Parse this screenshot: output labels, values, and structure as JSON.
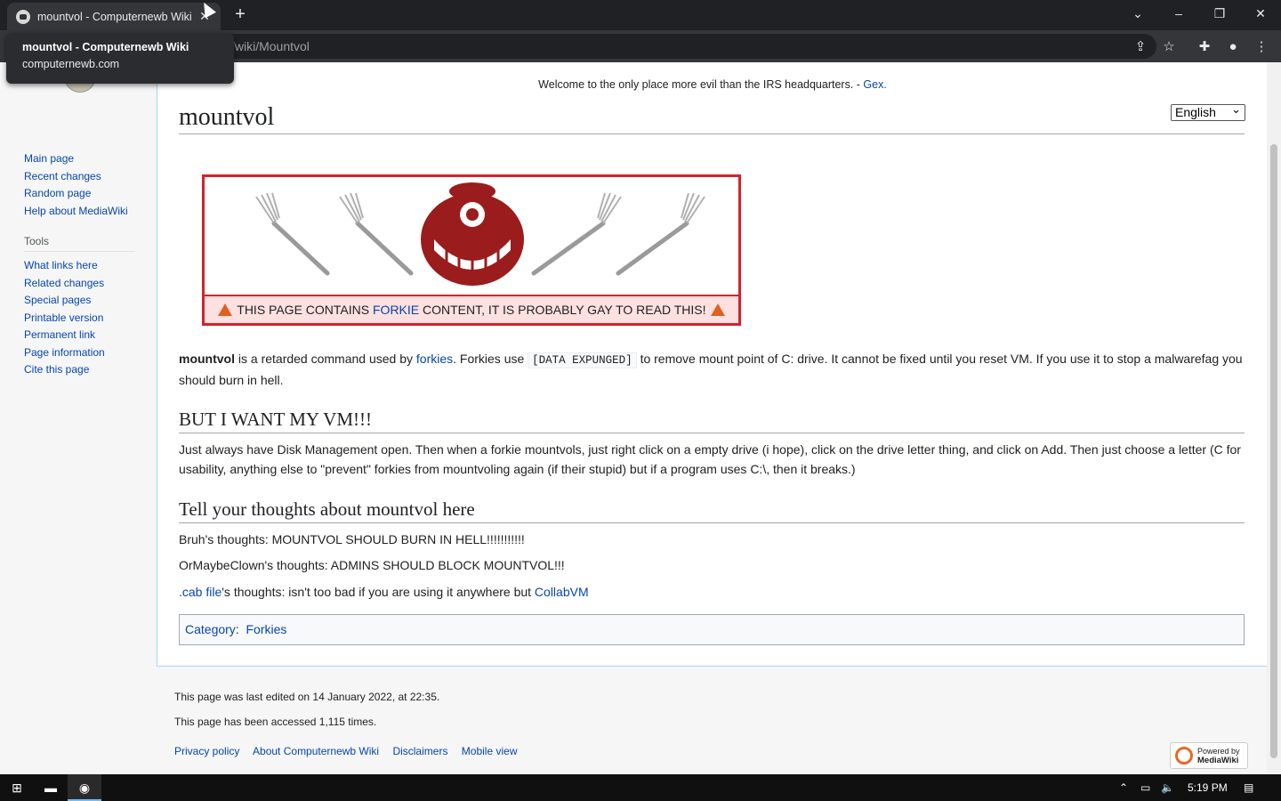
{
  "browser": {
    "tab_title": "mountvol - Computernewb Wiki",
    "address_tail": "/wiki/Mountvol",
    "tooltip_title": "mountvol - Computernewb Wiki",
    "tooltip_url": "computernewb.com",
    "icons": [
      "favicon-icon",
      "close-tab-icon",
      "new-tab-icon",
      "tab-search-icon",
      "minimize-icon",
      "restore-icon",
      "close-window-icon",
      "share-icon",
      "bookmark-star-icon",
      "extensions-icon",
      "profile-icon",
      "kebab-menu-icon"
    ]
  },
  "sidebar": {
    "nav": [
      "Main page",
      "Recent changes",
      "Random page",
      "Help about MediaWiki"
    ],
    "tools_heading": "Tools",
    "tools": [
      "What links here",
      "Related changes",
      "Special pages",
      "Printable version",
      "Permanent link",
      "Page information",
      "Cite this page"
    ]
  },
  "page": {
    "sitenotice_text": "Welcome to the only place more evil than the IRS headquarters. - ",
    "sitenotice_link": "Gex.",
    "language": "English",
    "title": "mountvol",
    "warning_pre": "THIS PAGE CONTAINS ",
    "warning_link": "FORKIE",
    "warning_post": " CONTENT, IT IS PROBABLY GAY TO READ THIS!",
    "intro_bold": "mountvol",
    "intro_1": " is a retarded command used by ",
    "intro_link": "forkies",
    "intro_2": ". Forkies use ",
    "intro_code": "[DATA EXPUNGED]",
    "intro_3": " to remove mount point of C: drive. It cannot be fixed until you reset VM. If you use it to stop a malwarefag you should burn in hell.",
    "h2_vm": "BUT I WANT MY VM!!!",
    "vm_text": "Just always have Disk Management open. Then when a forkie mountvols, just right click on a empty drive (i hope), click on the drive letter thing, and click on Add. Then just choose a letter (C for usability, anything else to \"prevent\" forkies from mountvoling again (if their stupid) but if a program uses C:\\, then it breaks.)",
    "h2_thoughts": "Tell your thoughts about mountvol here",
    "thought_1": "Bruh's thoughts: MOUNTVOL SHOULD BURN IN HELL!!!!!!!!!!!",
    "thought_2": "OrMaybeClown's thoughts: ADMINS SHOULD BLOCK MOUNTVOL!!!",
    "thought_3_link": ".cab file",
    "thought_3_text": "'s thoughts: isn't too bad if you are using it anywhere but ",
    "thought_3_link2": "CollabVM",
    "category_label": "Category",
    "category_value": "Forkies"
  },
  "footer": {
    "last_edited": "This page was last edited on 14 January 2022, at 22:35.",
    "accessed": "This page has been accessed 1,115 times.",
    "links": [
      "Privacy policy",
      "About Computernewb Wiki",
      "Disclaimers",
      "Mobile view"
    ],
    "powered_1": "Powered by",
    "powered_2": "MediaWiki"
  },
  "taskbar": {
    "time": "5:19 PM"
  },
  "colors": {
    "link": "#0645ad",
    "warning_border": "#d3232b",
    "warning_bg": "#fde0e0",
    "emblem": "#9b1c1c"
  }
}
